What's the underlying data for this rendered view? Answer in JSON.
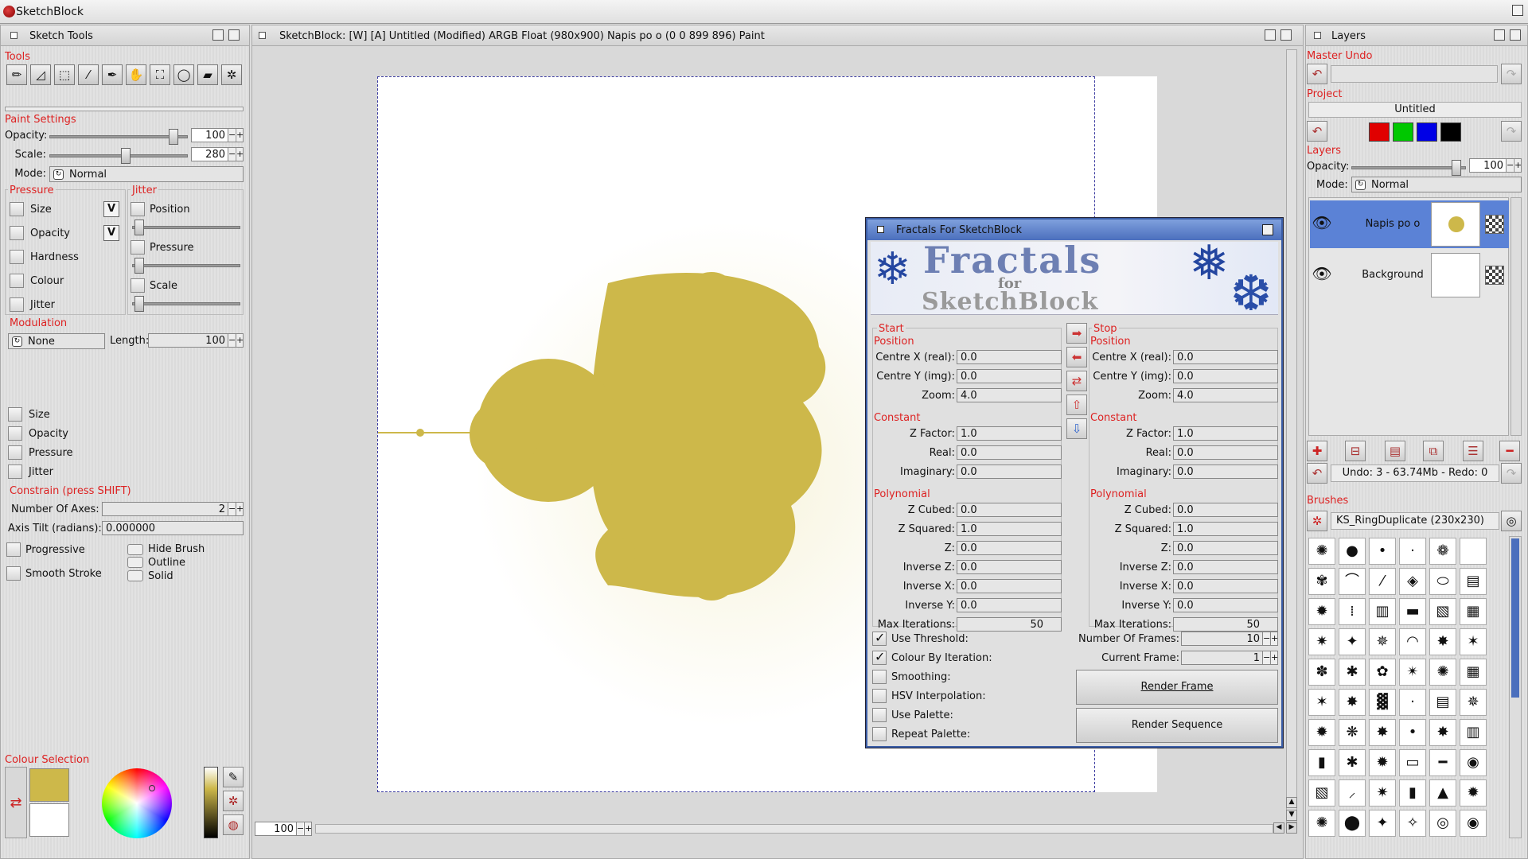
{
  "app": {
    "title": "SketchBlock"
  },
  "sketch_tools": {
    "title": "Sketch Tools",
    "tools_label": "Tools",
    "tools": [
      "pencil-icon",
      "ruler-icon",
      "select-icon",
      "eyedropper-icon",
      "pen-icon",
      "hand-icon",
      "transform-icon",
      "circle-icon",
      "eraser-icon",
      "brush-settings-icon"
    ],
    "paint_settings": "Paint Settings",
    "opacity_label": "Opacity:",
    "opacity": "100",
    "opacity_level": 0.92,
    "scale_label": "Scale:",
    "scale": "280",
    "scale_level": 0.55,
    "mode_label": "Mode:",
    "mode": "Normal",
    "pressure": "Pressure",
    "pressure_items": [
      "Size",
      "Opacity",
      "Hardness",
      "Colour",
      "Jitter"
    ],
    "v_label": "V",
    "jitter": "Jitter",
    "jitter_items": [
      "Position",
      "Pressure",
      "Scale"
    ],
    "modulation": "Modulation",
    "modulation_value": "None",
    "length_label": "Length:",
    "length": "100",
    "mod_items": [
      "Size",
      "Opacity",
      "Pressure",
      "Jitter"
    ],
    "constrain": "Constrain (press SHIFT)",
    "axes_label": "Number Of Axes:",
    "axes": "2",
    "tilt_label": "Axis Tilt (radians):",
    "tilt": "0.000000",
    "progressive": "Progressive",
    "smooth": "Smooth Stroke",
    "hide_brush": "Hide Brush",
    "outline": "Outline",
    "solid": "Solid",
    "colour_selection": "Colour Selection",
    "primary_color": "#cdb84a",
    "secondary_color": "#ffffff"
  },
  "canvas": {
    "title": "SketchBlock: [W] [A]  Untitled (Modified)  ARGB Float (980x900) Napis po o (0 0 899 896) Paint",
    "zoom": "100",
    "fractal_color": "#cdb84a"
  },
  "fractal_dialog": {
    "title": "Fractals For SketchBlock",
    "banner_title": "Fractals",
    "banner_for": "for",
    "banner_sub": "SketchBlock",
    "start": "Start",
    "stop": "Stop",
    "position": "Position",
    "constant": "Constant",
    "polynomial": "Polynomial",
    "rows_position": [
      {
        "label": "Centre X (real):",
        "start": "0.0",
        "stop": "0.0"
      },
      {
        "label": "Centre Y (img):",
        "start": "0.0",
        "stop": "0.0"
      },
      {
        "label": "Zoom:",
        "start": "4.0",
        "stop": "4.0"
      }
    ],
    "rows_constant": [
      {
        "label": "Z Factor:",
        "start": "1.0",
        "stop": "1.0"
      },
      {
        "label": "Real:",
        "start": "0.0",
        "stop": "0.0"
      },
      {
        "label": "Imaginary:",
        "start": "0.0",
        "stop": "0.0"
      }
    ],
    "rows_polynomial": [
      {
        "label": "Z Cubed:",
        "start": "0.0",
        "stop": "0.0"
      },
      {
        "label": "Z Squared:",
        "start": "1.0",
        "stop": "1.0"
      },
      {
        "label": "Z:",
        "start": "0.0",
        "stop": "0.0"
      },
      {
        "label": "Inverse Z:",
        "start": "0.0",
        "stop": "0.0"
      },
      {
        "label": "Inverse X:",
        "start": "0.0",
        "stop": "0.0"
      },
      {
        "label": "Inverse Y:",
        "start": "0.0",
        "stop": "0.0"
      }
    ],
    "max_iter_label": "Max Iterations:",
    "max_iter_start": "50",
    "max_iter_stop": "50",
    "options": [
      {
        "label": "Use Threshold:",
        "checked": true
      },
      {
        "label": "Colour By Iteration:",
        "checked": true
      },
      {
        "label": "Smoothing:",
        "checked": false
      },
      {
        "label": "HSV Interpolation:",
        "checked": false
      },
      {
        "label": "Use Palette:",
        "checked": false
      },
      {
        "label": "Repeat Palette:",
        "checked": false
      }
    ],
    "frames_label": "Number Of Frames:",
    "frames": "10",
    "current_frame_label": "Current Frame:",
    "current_frame": "1",
    "render_frame": "Render Frame",
    "render_sequence": "Render Sequence"
  },
  "layers_panel": {
    "title": "Layers",
    "master_undo": "Master Undo",
    "project": "Project",
    "project_name": "Untitled",
    "project_colors": [
      "#e00000",
      "#00c800",
      "#0000e6",
      "#000000"
    ],
    "layers_label": "Layers",
    "opacity_label": "Opacity:",
    "opacity": "100",
    "opacity_level": 0.95,
    "mode_label": "Mode:",
    "mode": "Normal",
    "layers": [
      {
        "name": "Napis po o",
        "selected": true
      },
      {
        "name": "Background",
        "selected": false
      }
    ],
    "undo_status": "Undo: 3 - 63.74Mb - Redo: 0",
    "brushes_label": "Brushes",
    "brush_name": "KS_RingDuplicate (230x230)",
    "brush_glyphs": [
      "✺",
      "●",
      "•",
      "·",
      "❁",
      " ",
      "✾",
      "⌒",
      "⁄",
      "◈",
      "⬭",
      "▤",
      "✹",
      "⁞",
      "▥",
      "▬",
      "▧",
      "▦",
      "✷",
      "✦",
      "✵",
      "◠",
      "✸",
      "✶",
      "✽",
      "✱",
      "✿",
      "✴",
      "✺",
      "▦",
      "✶",
      "✸",
      "▓",
      "·",
      "▤",
      "✵",
      "✹",
      "❋",
      "✸",
      "•",
      "✸",
      "▥",
      "▮",
      "✱",
      "✹",
      "▭",
      "━",
      "◉",
      "▧",
      "⸝",
      "✷",
      "▮",
      "▲",
      "✹",
      "✺",
      "⬤",
      "✦",
      "✧",
      "◎",
      "◉"
    ]
  }
}
